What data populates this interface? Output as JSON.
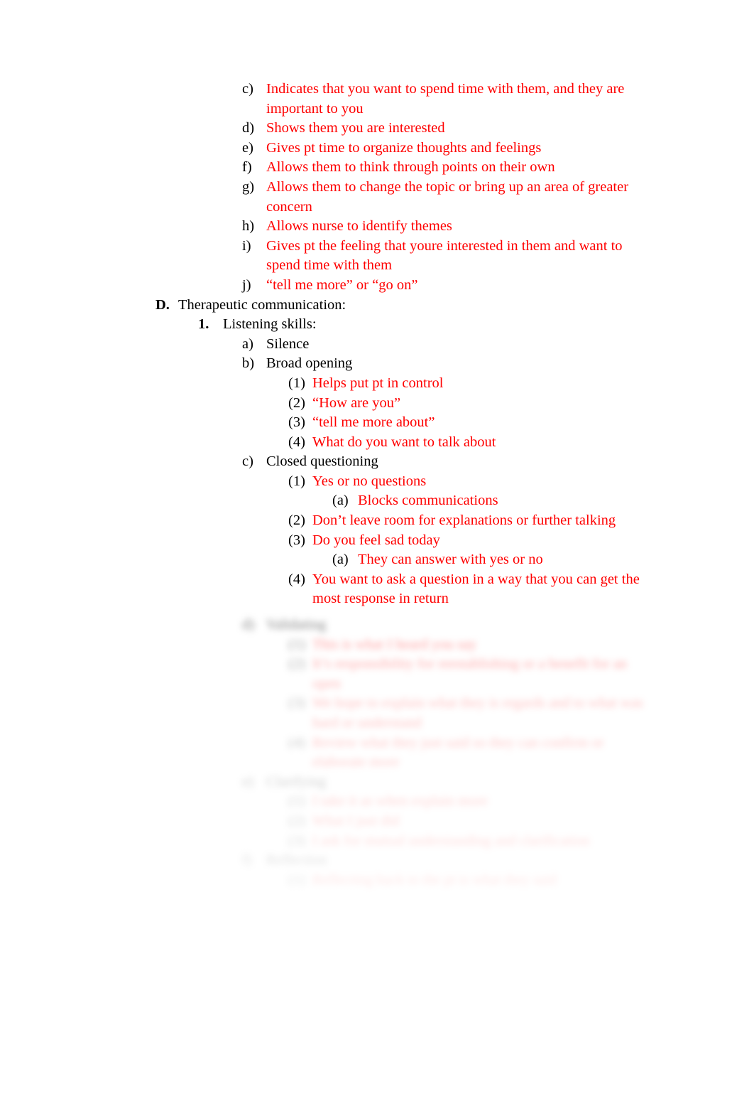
{
  "document": {
    "page_background": "#ffffff",
    "text_color": "#000000",
    "highlight_color": "#ff0000",
    "title_visible": false
  },
  "outline": {
    "continued_list": [
      {
        "marker": "c)",
        "text": "Indicates that you want to spend time with them, and they are important to you",
        "color": "red"
      },
      {
        "marker": "d)",
        "text": "Shows them you are interested",
        "color": "red"
      },
      {
        "marker": "e)",
        "text": "Gives pt time to organize thoughts and feelings",
        "color": "red"
      },
      {
        "marker": "f)",
        "text": "Allows them to think through points on their own",
        "color": "red"
      },
      {
        "marker": "g)",
        "text": "Allows them to change the topic or bring up an area of greater concern",
        "color": "red"
      },
      {
        "marker": "h)",
        "text": "Allows nurse to identify themes",
        "color": "red"
      },
      {
        "marker": "i)",
        "text": "Gives pt the feeling that youre interested in them and want to spend time with them",
        "color": "red"
      },
      {
        "marker": "j)",
        "text": "“tell me more” or “go on”",
        "color": "red"
      }
    ],
    "section_D": {
      "marker": "D.",
      "text": "Therapeutic communication:",
      "color": "black",
      "bold_marker": true
    },
    "section_D_1": {
      "marker": "1.",
      "text": "Listening skills:",
      "color": "black",
      "bold_marker": true
    },
    "listening_skills": [
      {
        "marker": "a)",
        "text": "Silence",
        "color": "black",
        "children": []
      },
      {
        "marker": "b)",
        "text": " Broad opening",
        "color": "black",
        "children": [
          {
            "marker": "(1)",
            "text": "Helps put pt in control",
            "color": "red"
          },
          {
            "marker": "(2)",
            "text": "“How are you”",
            "color": "red"
          },
          {
            "marker": "(3)",
            "text": "“tell me more about”",
            "color": "red"
          },
          {
            "marker": "(4)",
            "text": "What do you want to talk about",
            "color": "red"
          }
        ]
      },
      {
        "marker": "c)",
        "text": "Closed questioning",
        "color": "black",
        "children": [
          {
            "marker": "(1)",
            "text": "Yes or no questions",
            "color": "red",
            "children": [
              {
                "marker": "(a)",
                "text": "Blocks communications",
                "color": "red"
              }
            ]
          },
          {
            "marker": "(2)",
            "text": "Don’t leave room for explanations or further talking",
            "color": "red"
          },
          {
            "marker": "(3)",
            "text": "Do you feel sad today",
            "color": "red",
            "children": [
              {
                "marker": "(a)",
                "text": "They can answer with yes or no",
                "color": "red"
              }
            ]
          },
          {
            "marker": "(4)",
            "text": "You want to ask a question in a way that you can get the most response in return",
            "color": "red"
          }
        ]
      }
    ],
    "obscured_region": {
      "note_visible_state": "blurred-and-faded",
      "items": [
        {
          "marker": "d)",
          "text": "Validating",
          "color": "black",
          "children": [
            {
              "marker": "(1)",
              "text": "This is what I heard you say",
              "color": "red"
            },
            {
              "marker": "(2)",
              "text": "It’s responsibility for reestablishing or a benefit for an open",
              "color": "red"
            },
            {
              "marker": "(3)",
              "text": "We hope to explain what they is regards and to what was hard or understand",
              "color": "red"
            },
            {
              "marker": "(4)",
              "text": "Review what they just said so they can confirm or elaborate more",
              "color": "red"
            }
          ]
        },
        {
          "marker": "e)",
          "text": "Clarifying",
          "color": "black",
          "children": [
            {
              "marker": "(1)",
              "text": "I take it as when explain more",
              "color": "red"
            },
            {
              "marker": "(2)",
              "text": "What I just did",
              "color": "red"
            },
            {
              "marker": "(3)",
              "text": "I ask for mutual understanding and clarification",
              "color": "red"
            }
          ]
        },
        {
          "marker": "f)",
          "text": "Reflection",
          "color": "black",
          "children": [
            {
              "marker": "(1)",
              "text": "Reflecting back to the pt is what they said",
              "color": "red"
            }
          ]
        }
      ]
    }
  }
}
